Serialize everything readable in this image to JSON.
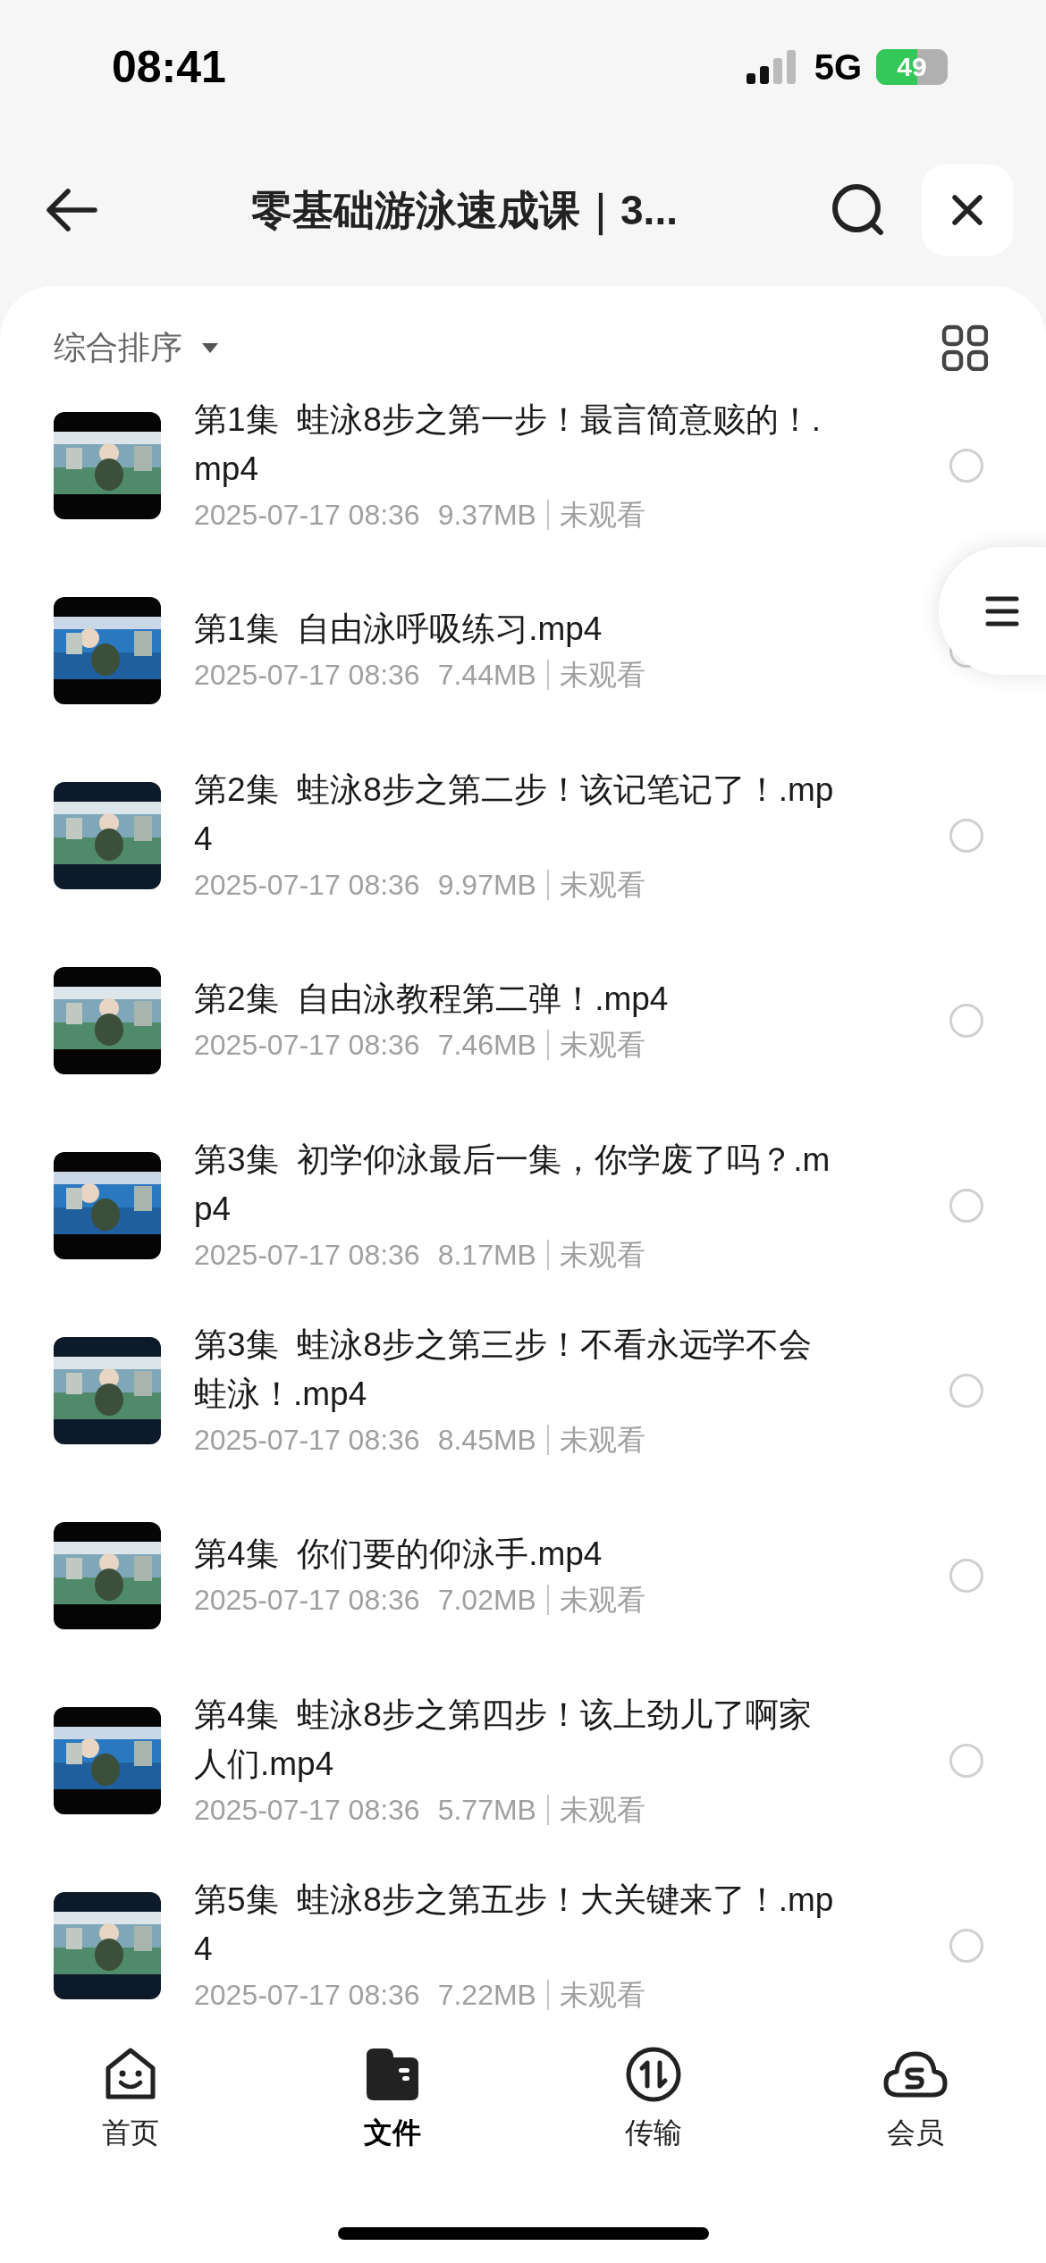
{
  "status_bar": {
    "time": "08:41",
    "network": "5G",
    "battery": "49"
  },
  "header": {
    "title": "零基础游泳速成课｜3..."
  },
  "sort": {
    "label": "综合排序"
  },
  "files": [
    {
      "title": "第1集  蛙泳8步之第一步！最言简意赅的！.mp4",
      "date": "2025-07-17 08:36",
      "size": "9.37MB",
      "status": "未观看",
      "selected": false
    },
    {
      "title": "第1集  自由泳呼吸练习.mp4",
      "date": "2025-07-17 08:36",
      "size": "7.44MB",
      "status": "未观看",
      "selected": false
    },
    {
      "title": "第2集  蛙泳8步之第二步！该记笔记了！.mp4",
      "date": "2025-07-17 08:36",
      "size": "9.97MB",
      "status": "未观看",
      "selected": false
    },
    {
      "title": "第2集  自由泳教程第二弹！.mp4",
      "date": "2025-07-17 08:36",
      "size": "7.46MB",
      "status": "未观看",
      "selected": false
    },
    {
      "title": "第3集  初学仰泳最后一集，你学废了吗？.mp4",
      "date": "2025-07-17 08:36",
      "size": "8.17MB",
      "status": "未观看",
      "selected": false
    },
    {
      "title": "第3集  蛙泳8步之第三步！不看永远学不会蛙泳！.mp4",
      "date": "2025-07-17 08:36",
      "size": "8.45MB",
      "status": "未观看",
      "selected": false
    },
    {
      "title": "第4集  你们要的仰泳手.mp4",
      "date": "2025-07-17 08:36",
      "size": "7.02MB",
      "status": "未观看",
      "selected": false
    },
    {
      "title": "第4集  蛙泳8步之第四步！该上劲儿了啊家人们.mp4",
      "date": "2025-07-17 08:36",
      "size": "5.77MB",
      "status": "未观看",
      "selected": false
    },
    {
      "title": "第5集  蛙泳8步之第五步！大关键来了！.mp4",
      "date": "2025-07-17 08:36",
      "size": "7.22MB",
      "status": "未观看",
      "selected": false
    }
  ],
  "tab_bar": [
    {
      "kind": "home",
      "label": "首页",
      "selected": false
    },
    {
      "kind": "files",
      "label": "文件",
      "selected": true
    },
    {
      "kind": "transfer",
      "label": "传输",
      "selected": false
    },
    {
      "kind": "member",
      "label": "会员",
      "selected": false
    }
  ]
}
